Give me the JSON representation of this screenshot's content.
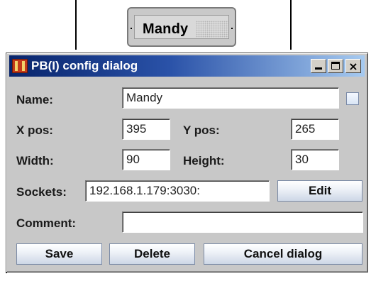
{
  "background": {
    "node_label": "Mandy"
  },
  "dialog": {
    "title": "PB(I) config dialog",
    "title_bar_colors": {
      "start": "#08246b",
      "end": "#a6caf0"
    },
    "window_buttons": {
      "minimize": "minimize-icon",
      "maximize": "maximize-icon",
      "close": "×"
    },
    "name": {
      "label": "Name:",
      "value": "Mandy",
      "checkbox_checked": false
    },
    "xpos": {
      "label": "X pos:",
      "value": "395"
    },
    "ypos": {
      "label": "Y pos:",
      "value": "265"
    },
    "width": {
      "label": "Width:",
      "value": "90"
    },
    "height": {
      "label": "Height:",
      "value": "30"
    },
    "sockets": {
      "label": "Sockets:",
      "value": "192.168.1.179:3030:",
      "edit_label": "Edit"
    },
    "comment": {
      "label": "Comment:",
      "value": ""
    },
    "buttons": {
      "save": "Save",
      "delete": "Delete",
      "cancel": "Cancel dialog"
    }
  }
}
